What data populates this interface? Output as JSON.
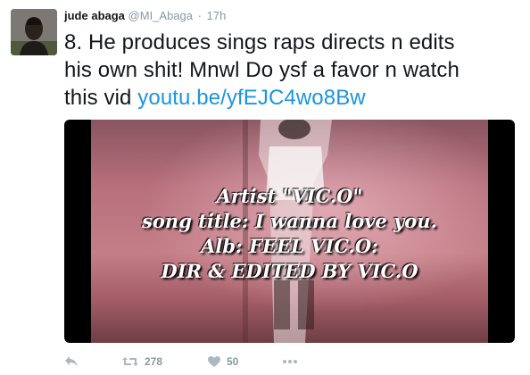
{
  "tweet": {
    "author_name": "jude abaga",
    "author_handle": "@MI_Abaga",
    "separator": "·",
    "time": "17h",
    "text_lines": [
      "8. He produces sings raps directs n edits",
      "his own shit! Mnwl Do ysf a favor n watch",
      "this vid "
    ],
    "link_text": "youtu.be/yfEJC4wo8Bw",
    "media_overlay_lines": [
      "Artist \"VIC.O\"",
      "song title: I wanna love you.",
      "Alb: FEEL VIC.O:",
      "DIR & EDITED BY VIC.O"
    ],
    "actions": {
      "reply_icon": "reply-icon",
      "retweet_icon": "retweet-icon",
      "retweet_count": "278",
      "like_icon": "heart-icon",
      "like_count": "50",
      "more_icon": "more-icon"
    }
  },
  "colors": {
    "text": "#14171a",
    "secondary": "#8899a6",
    "link": "#1b95e0",
    "icon": "#aab8c2"
  }
}
